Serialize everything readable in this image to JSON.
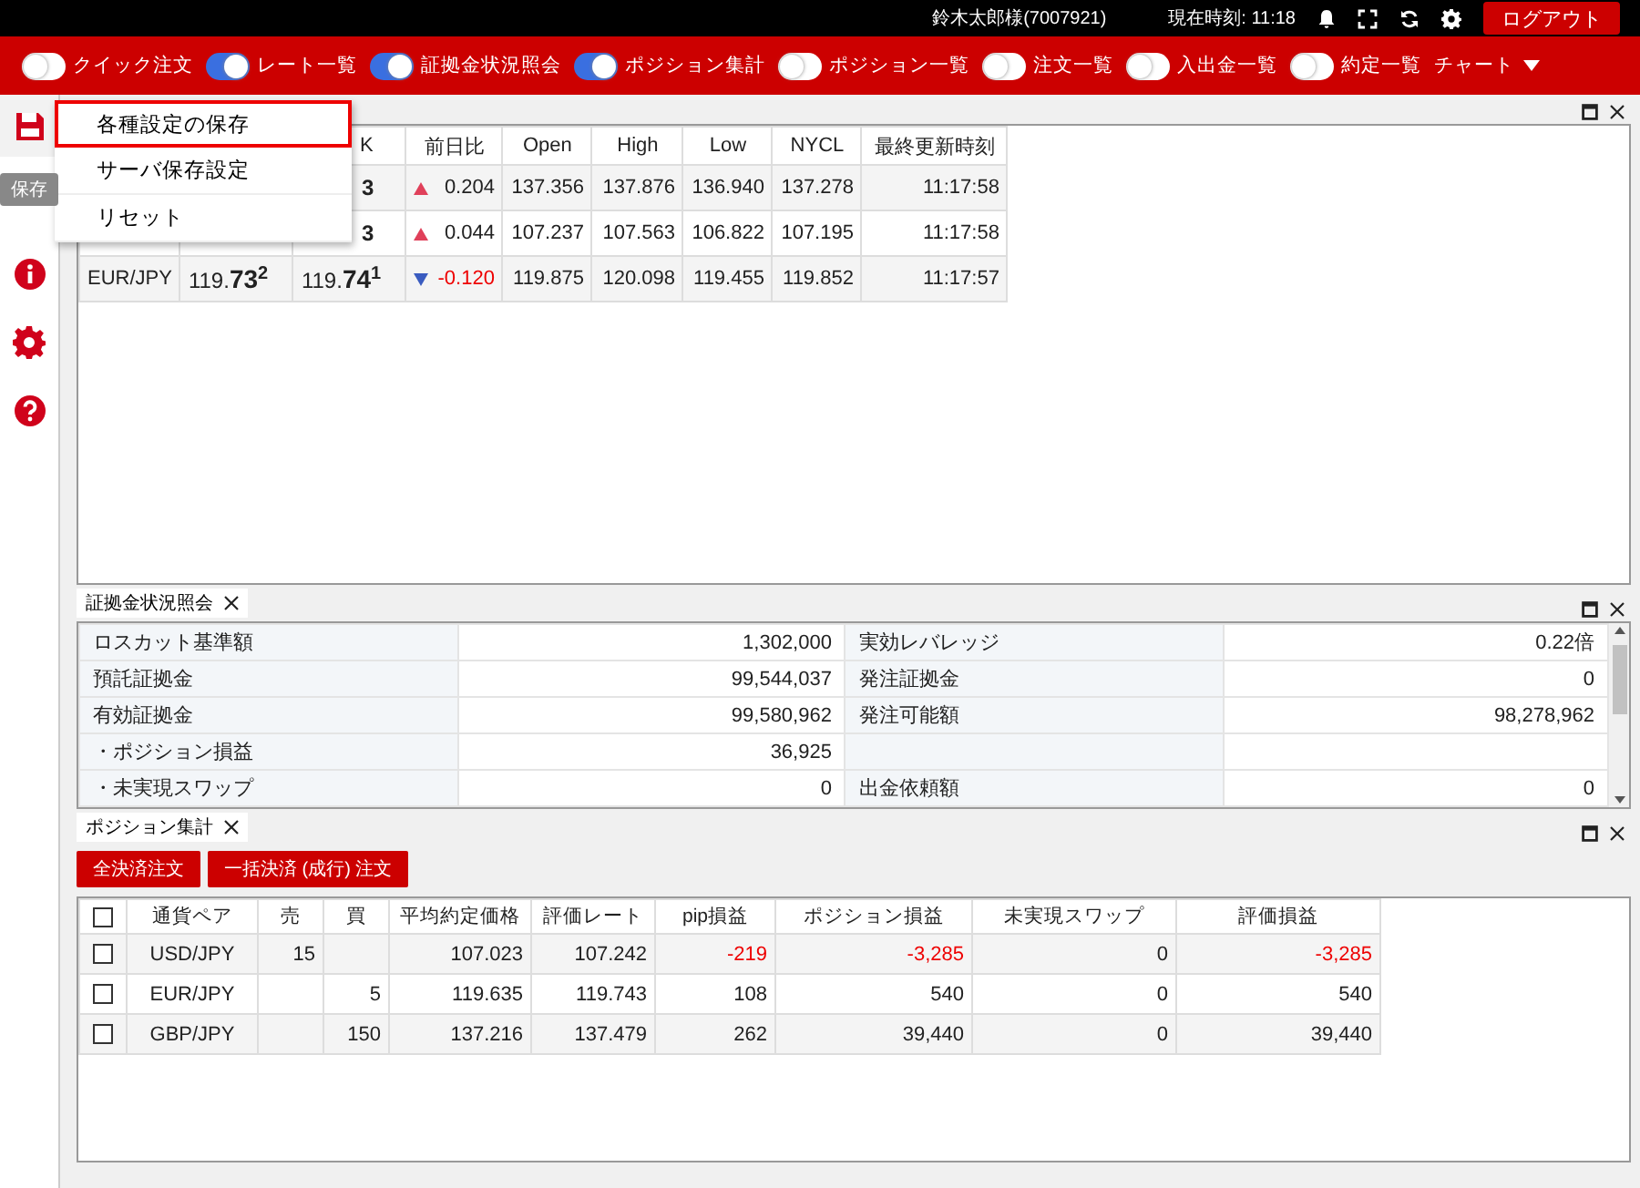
{
  "top_bar": {
    "user": "鈴木太郎様(7007921)",
    "clock": "現在時刻: 11:18",
    "logout": "ログアウト"
  },
  "toolbar": {
    "toggles": [
      {
        "label": "クイック注文",
        "on": false
      },
      {
        "label": "レート一覧",
        "on": true
      },
      {
        "label": "証拠金状況照会",
        "on": true
      },
      {
        "label": "ポジション集計",
        "on": true
      },
      {
        "label": "ポジション一覧",
        "on": false
      },
      {
        "label": "注文一覧",
        "on": false
      },
      {
        "label": "入出金一覧",
        "on": false
      },
      {
        "label": "約定一覧",
        "on": false
      }
    ],
    "chart_menu": "チャート"
  },
  "sidebar": {
    "tooltip": "保存"
  },
  "save_menu": {
    "items": [
      {
        "label": "各種設定の保存",
        "selected": true
      },
      {
        "label": "サーバ保存設定",
        "selected": false
      },
      {
        "label": "リセット",
        "selected": false
      }
    ]
  },
  "rate_panel": {
    "columns": [
      "K",
      "前日比",
      "Open",
      "High",
      "Low",
      "NYCL",
      "最終更新時刻"
    ],
    "rows": [
      {
        "ask": "3",
        "down": false,
        "change": "0.204",
        "open": "137.356",
        "high": "137.876",
        "low": "136.940",
        "nycl": "137.278",
        "time": "11:17:58"
      },
      {
        "ask": "3",
        "down": false,
        "change": "0.044",
        "open": "107.237",
        "high": "107.563",
        "low": "106.822",
        "nycl": "107.195",
        "time": "11:17:58"
      },
      {
        "pair": "EUR/JPY",
        "bid": "119.**73**$^{2}$",
        "ask": "119.**74**$^{1}$",
        "down": true,
        "change": "-0.120",
        "open": "119.875",
        "high": "120.098",
        "low": "119.455",
        "nycl": "119.852",
        "time": "11:17:57"
      }
    ]
  },
  "margin_panel": {
    "tab": "証拠金状況照会",
    "rows": [
      {
        "label": "ロスカット基準額",
        "value": "1,302,000",
        "label2": "実効レバレッジ",
        "value2": "0.22倍"
      },
      {
        "label": "預託証拠金",
        "value": "99,544,037",
        "label2": "発注証拠金",
        "value2": "0"
      },
      {
        "label": "有効証拠金",
        "value": "99,580,962",
        "label2": "発注可能額",
        "value2": "98,278,962"
      },
      {
        "label": "・ポジション損益",
        "value": "36,925"
      },
      {
        "label": "・未実現スワップ",
        "value": "0",
        "label2": "出金依頼額",
        "value2": "0"
      }
    ]
  },
  "position_panel": {
    "tab": "ポジション集計",
    "buttons": [
      "全決済注文",
      "一括決済 (成行) 注文"
    ],
    "header_checked": false,
    "columns": [
      "通貨ペア",
      "売",
      "買",
      "平均約定価格",
      "評価レート",
      "pip損益",
      "ポジション損益",
      "未実現スワップ",
      "評価損益"
    ],
    "rows": [
      {
        "checked": false,
        "negative": true,
        "cells": [
          "USD/JPY",
          "15",
          "",
          "107.023",
          "107.242",
          "-219",
          "-3,285",
          "0",
          "-3,285"
        ]
      },
      {
        "checked": false,
        "negative": false,
        "cells": [
          "EUR/JPY",
          "",
          "5",
          "119.635",
          "119.743",
          "108",
          "540",
          "0",
          "540"
        ]
      },
      {
        "checked": false,
        "negative": false,
        "cells": [
          "GBP/JPY",
          "",
          "150",
          "137.216",
          "137.479",
          "262",
          "39,440",
          "0",
          "39,440"
        ]
      }
    ]
  }
}
